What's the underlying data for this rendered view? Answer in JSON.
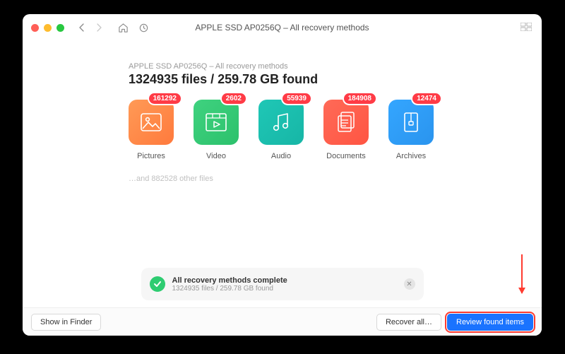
{
  "titlebar": {
    "title": "APPLE SSD AP0256Q – All recovery methods"
  },
  "summary": {
    "subtitle": "APPLE SSD AP0256Q – All recovery methods",
    "headline": "1324935 files / 259.78 GB found"
  },
  "categories": [
    {
      "key": "pictures",
      "label": "Pictures",
      "badge": "161292"
    },
    {
      "key": "video",
      "label": "Video",
      "badge": "2602"
    },
    {
      "key": "audio",
      "label": "Audio",
      "badge": "55939"
    },
    {
      "key": "documents",
      "label": "Documents",
      "badge": "184908"
    },
    {
      "key": "archives",
      "label": "Archives",
      "badge": "12474"
    }
  ],
  "other_files": "…and 882528 other files",
  "status": {
    "title": "All recovery methods complete",
    "subtitle": "1324935 files / 259.78 GB found"
  },
  "footer": {
    "show_in_finder": "Show in Finder",
    "recover_all": "Recover all…",
    "review": "Review found items"
  }
}
